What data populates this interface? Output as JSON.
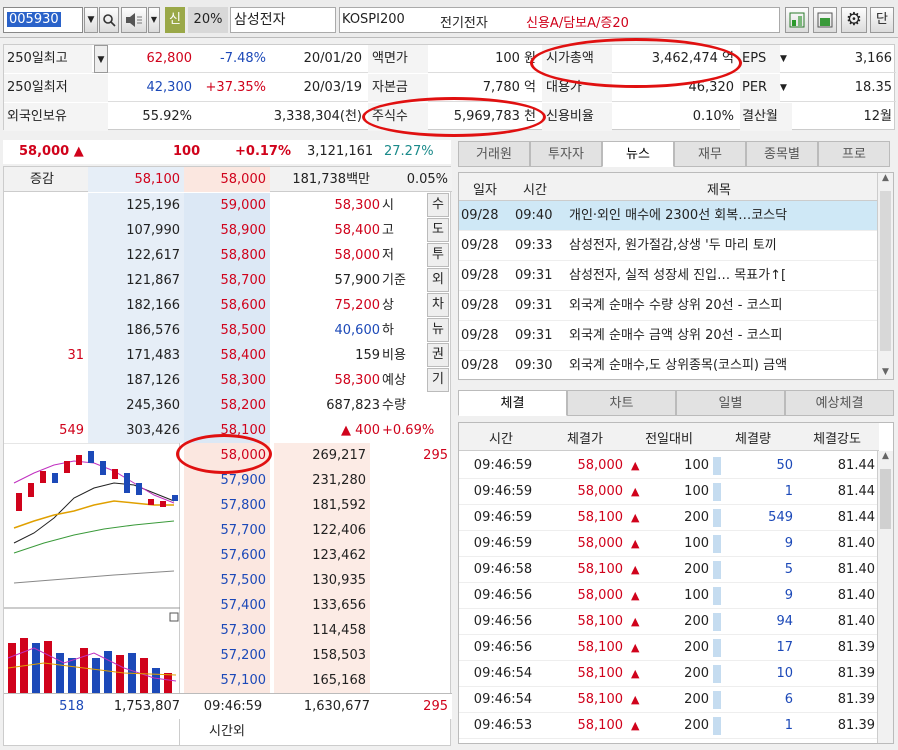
{
  "toolbar": {
    "code": "005930",
    "search_icon": "search-icon",
    "pct": "20%",
    "name": "삼성전자",
    "flag": "신",
    "market": "KOSPI200",
    "sector": "전기전자",
    "credit": "신용A/담보A/증20",
    "btn_last": "단"
  },
  "info": {
    "r1": {
      "l1": "250일최고",
      "v1": "62,800",
      "v2": "-7.48%",
      "v3": "20/01/20",
      "l2": "액면가",
      "v4": "100 원",
      "l3": "시가총액",
      "v5": "3,462,474 억",
      "l4": "EPS",
      "v6": "3,166"
    },
    "r2": {
      "l1": "250일최저",
      "v1": "42,300",
      "v2": "+37.35%",
      "v3": "20/03/19",
      "l2": "자본금",
      "v4": "7,780 억",
      "l3": "대용가",
      "v5": "46,320",
      "l4": "PER",
      "v6": "18.35"
    },
    "r3": {
      "l1": "외국인보유",
      "v1": "55.92%",
      "v3": "3,338,304(천)",
      "l2": "주식수",
      "v4": "5,969,783 천",
      "l3": "신용비율",
      "v5": "0.10%",
      "l4": "결산월",
      "v6": "12월"
    }
  },
  "price": {
    "cur": "58,000 ▲",
    "chg": "100",
    "pct": "+0.17%",
    "vol": "3,121,161",
    "rate": "27.27%"
  },
  "ob_head": {
    "label": "증감",
    "p1": "58,100",
    "p2": "58,000",
    "amt": "181,738백만",
    "pct": "0.05%"
  },
  "asks": [
    {
      "q": "125,196",
      "p": "59,000",
      "inc": ""
    },
    {
      "q": "107,990",
      "p": "58,900",
      "inc": ""
    },
    {
      "q": "122,617",
      "p": "58,800",
      "inc": ""
    },
    {
      "q": "121,867",
      "p": "58,700",
      "inc": ""
    },
    {
      "q": "182,166",
      "p": "58,600",
      "inc": ""
    },
    {
      "q": "186,576",
      "p": "58,500",
      "inc": ""
    },
    {
      "q": "171,483",
      "p": "58,400",
      "inc": "31"
    },
    {
      "q": "187,126",
      "p": "58,300",
      "inc": ""
    },
    {
      "q": "245,360",
      "p": "58,200",
      "inc": ""
    },
    {
      "q": "303,426",
      "p": "58,100",
      "inc": "549"
    }
  ],
  "stats": [
    {
      "v": "58,300",
      "k": "시"
    },
    {
      "v": "58,400",
      "k": "고"
    },
    {
      "v": "58,000",
      "k": "저"
    },
    {
      "v": "57,900",
      "k": "기준"
    },
    {
      "v": "75,200",
      "k": "상"
    },
    {
      "v": "40,600",
      "k": "하"
    },
    {
      "v": "159",
      "k": "비용"
    },
    {
      "v": "58,300",
      "k": "예상"
    },
    {
      "v": "687,823",
      "k": "수량"
    },
    {
      "v": "▲ 400",
      "k": "+0.69%"
    }
  ],
  "side_tabs": [
    "수",
    "도",
    "투",
    "외",
    "차",
    "뉴",
    "권",
    "기"
  ],
  "bids": [
    {
      "p": "58,000",
      "q": "269,217",
      "inc": "295"
    },
    {
      "p": "57,900",
      "q": "231,280",
      "inc": ""
    },
    {
      "p": "57,800",
      "q": "181,592",
      "inc": ""
    },
    {
      "p": "57,700",
      "q": "122,406",
      "inc": ""
    },
    {
      "p": "57,600",
      "q": "123,462",
      "inc": ""
    },
    {
      "p": "57,500",
      "q": "130,935",
      "inc": ""
    },
    {
      "p": "57,400",
      "q": "133,656",
      "inc": ""
    },
    {
      "p": "57,300",
      "q": "114,458",
      "inc": ""
    },
    {
      "p": "57,200",
      "q": "158,503",
      "inc": ""
    },
    {
      "p": "57,100",
      "q": "165,168",
      "inc": ""
    }
  ],
  "ob_foot": {
    "a": "518",
    "b": "1,753,807",
    "time": "09:46:59",
    "c": "1,630,677",
    "d": "295",
    "after": "시간외"
  },
  "top_tabs": [
    "거래원",
    "투자자",
    "뉴스",
    "재무",
    "종목별",
    "프로"
  ],
  "news_head": {
    "date": "일자",
    "time": "시간",
    "title": "제목"
  },
  "news": [
    {
      "d": "09/28",
      "t": "09:40",
      "s": "개인·외인 매수에 2300선 회복…코스닥"
    },
    {
      "d": "09/28",
      "t": "09:33",
      "s": "삼성전자, 원가절감,상생 '두 마리 토끼"
    },
    {
      "d": "09/28",
      "t": "09:31",
      "s": "삼성전자, 실적 성장세 진입… 목표가↑["
    },
    {
      "d": "09/28",
      "t": "09:31",
      "s": "외국계 순매수 수량 상위 20선 - 코스피"
    },
    {
      "d": "09/28",
      "t": "09:31",
      "s": "외국계 순매수 금액 상위 20선 - 코스피"
    },
    {
      "d": "09/28",
      "t": "09:30",
      "s": "외국계 순매수,도 상위종목(코스피) 금액"
    }
  ],
  "bot_tabs": [
    "체결",
    "차트",
    "일별",
    "예상체결"
  ],
  "trade_head": [
    "시간",
    "체결가",
    "전일대비",
    "체결량",
    "체결강도"
  ],
  "trades": [
    {
      "t": "09:46:59",
      "p": "58,000",
      "c": "100",
      "v": "50",
      "s": "81.44"
    },
    {
      "t": "09:46:59",
      "p": "58,000",
      "c": "100",
      "v": "1",
      "s": "81.44"
    },
    {
      "t": "09:46:59",
      "p": "58,100",
      "c": "200",
      "v": "549",
      "s": "81.44"
    },
    {
      "t": "09:46:59",
      "p": "58,000",
      "c": "100",
      "v": "9",
      "s": "81.40"
    },
    {
      "t": "09:46:58",
      "p": "58,100",
      "c": "200",
      "v": "5",
      "s": "81.40"
    },
    {
      "t": "09:46:56",
      "p": "58,000",
      "c": "100",
      "v": "9",
      "s": "81.40"
    },
    {
      "t": "09:46:56",
      "p": "58,100",
      "c": "200",
      "v": "94",
      "s": "81.40"
    },
    {
      "t": "09:46:56",
      "p": "58,100",
      "c": "200",
      "v": "17",
      "s": "81.39"
    },
    {
      "t": "09:46:54",
      "p": "58,100",
      "c": "200",
      "v": "10",
      "s": "81.39"
    },
    {
      "t": "09:46:54",
      "p": "58,100",
      "c": "200",
      "v": "6",
      "s": "81.39"
    },
    {
      "t": "09:46:53",
      "p": "58,100",
      "c": "200",
      "v": "1",
      "s": "81.39"
    }
  ],
  "colors": {
    "up": "#d0021b",
    "down": "#1c49b8",
    "ask_bg": "#dce8f5",
    "bid_bg": "#fbe3dc",
    "annotation": "#e01010"
  }
}
